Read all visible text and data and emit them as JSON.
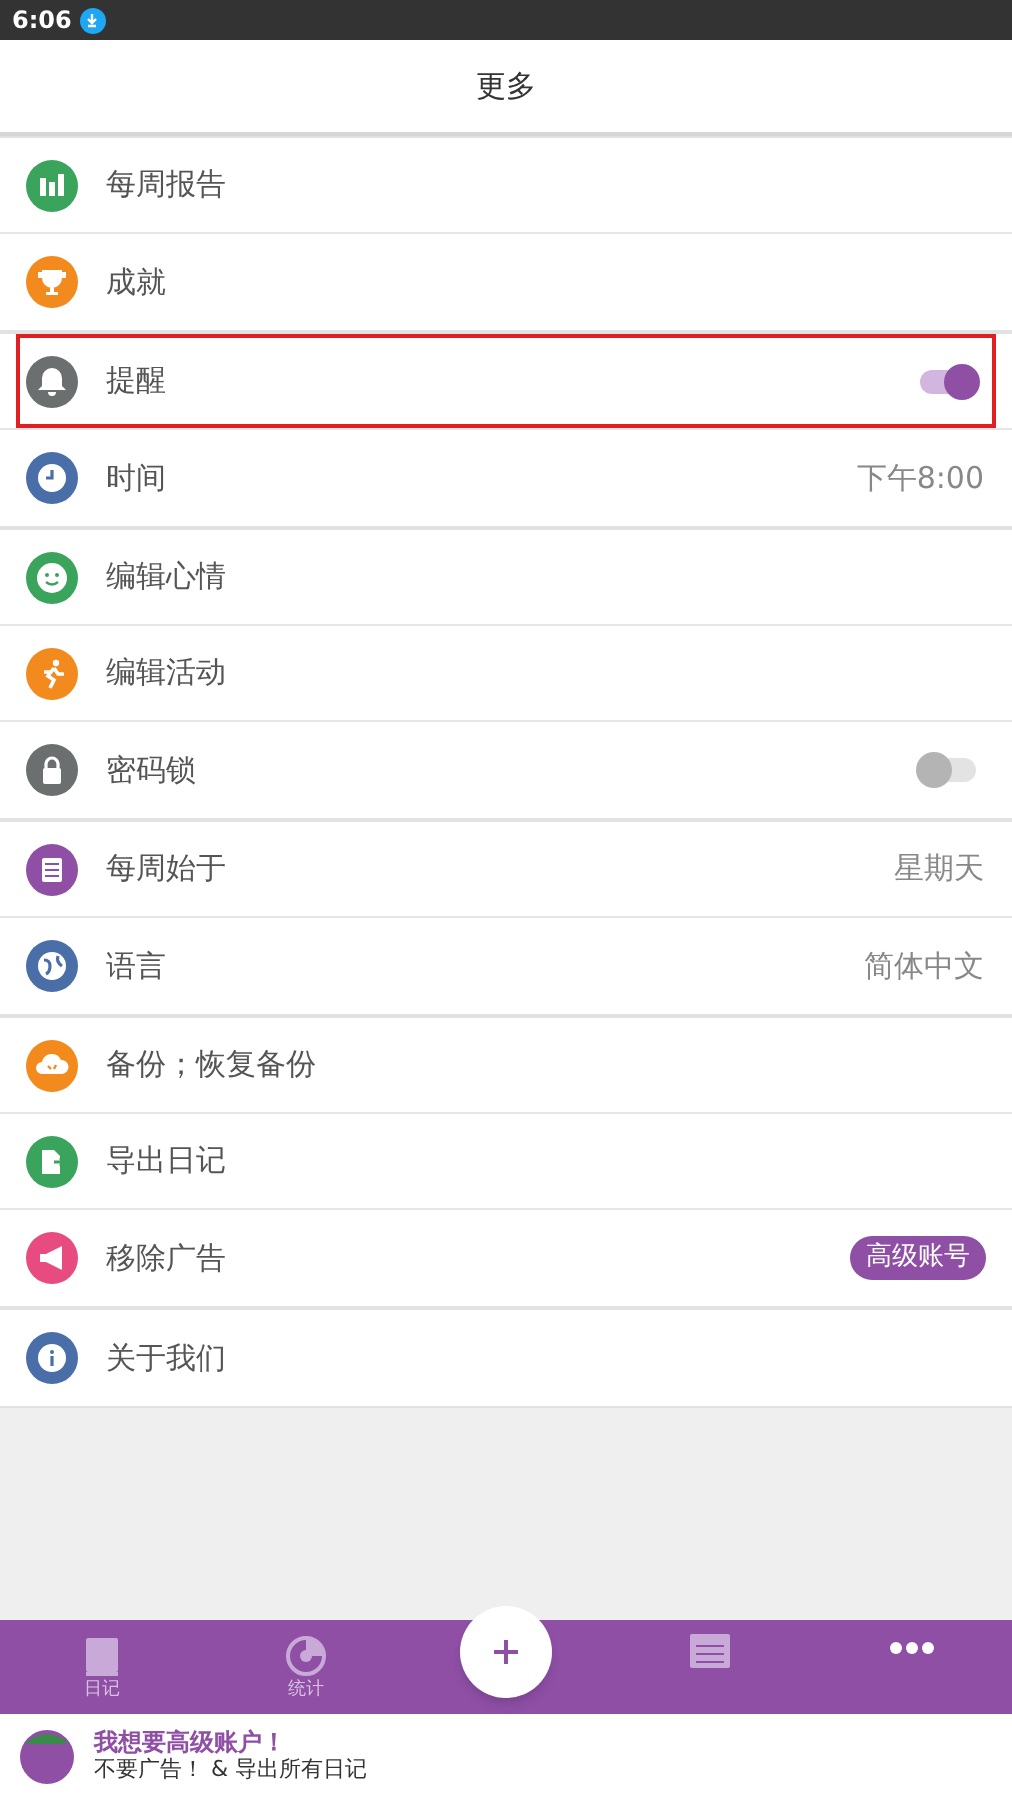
{
  "status_bar": {
    "time": "6:06"
  },
  "header": {
    "title": "更多"
  },
  "groups": [
    {
      "items": [
        {
          "kind": "plain",
          "label": "每周报告",
          "highlighted": false
        },
        {
          "kind": "plain",
          "label": "成就",
          "highlighted": false
        }
      ]
    },
    {
      "items": [
        {
          "kind": "toggle",
          "label": "提醒",
          "on": true,
          "highlighted": true
        },
        {
          "kind": "value",
          "label": "时间",
          "value": "下午8:00",
          "highlighted": false
        }
      ]
    },
    {
      "items": [
        {
          "kind": "plain",
          "label": "编辑心情",
          "highlighted": false
        },
        {
          "kind": "plain",
          "label": "编辑活动",
          "highlighted": false
        },
        {
          "kind": "toggle",
          "label": "密码锁",
          "on": false,
          "highlighted": false
        }
      ]
    },
    {
      "items": [
        {
          "kind": "value",
          "label": "每周始于",
          "value": "星期天",
          "highlighted": false
        },
        {
          "kind": "value",
          "label": "语言",
          "value": "简体中文",
          "highlighted": false
        }
      ]
    },
    {
      "items": [
        {
          "kind": "plain",
          "label": "备份；恢复备份",
          "highlighted": false
        },
        {
          "kind": "plain",
          "label": "导出日记",
          "highlighted": false
        },
        {
          "kind": "badge",
          "label": "移除广告",
          "badge": "高级账号",
          "highlighted": false
        }
      ]
    },
    {
      "items": [
        {
          "kind": "plain",
          "label": "关于我们",
          "highlighted": false
        }
      ]
    }
  ],
  "bottom_nav": {
    "tabs": [
      {
        "label": "日记"
      },
      {
        "label": "统计"
      }
    ]
  },
  "promo": {
    "title": "我想要高级账户！",
    "subtitle": "不要广告！ & 导出所有日记"
  }
}
